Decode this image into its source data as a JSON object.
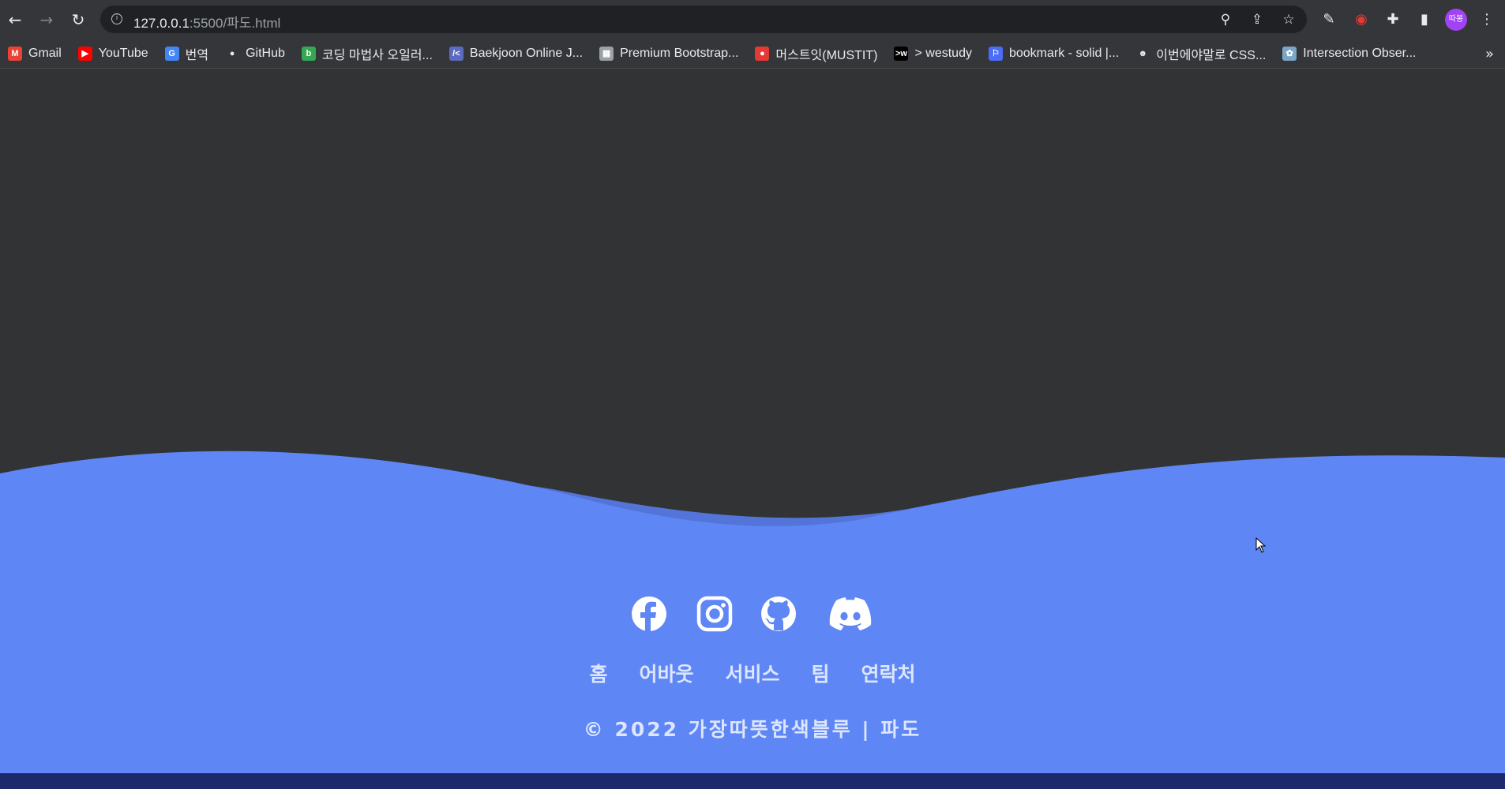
{
  "browser": {
    "url_host": "127.0.0.1",
    "url_rest": ":5500/파도.html",
    "profile_label": "따봉"
  },
  "bookmarks": [
    {
      "label": "Gmail",
      "color": "#ea4335",
      "glyph": "M"
    },
    {
      "label": "YouTube",
      "color": "#ff0000",
      "glyph": "▶"
    },
    {
      "label": "번역",
      "color": "#4285f4",
      "glyph": "G"
    },
    {
      "label": "GitHub",
      "color": "#e8eaed",
      "glyph": "●"
    },
    {
      "label": "코딩 마법사 오일러...",
      "color": "#34a853",
      "glyph": "b"
    },
    {
      "label": "Baekjoon Online J...",
      "color": "#5c6bc0",
      "glyph": "/<"
    },
    {
      "label": "Premium Bootstrap...",
      "color": "#9aa0a6",
      "glyph": "▦"
    },
    {
      "label": "머스트잇(MUSTIT)",
      "color": "#e53935",
      "glyph": "●"
    },
    {
      "label": "> westudy",
      "color": "#000000",
      "glyph": ">w"
    },
    {
      "label": "bookmark - solid |...",
      "color": "#4a6cf7",
      "glyph": "⚐"
    },
    {
      "label": "이번에야말로 CSS...",
      "color": "#e8eaed",
      "glyph": "☻"
    },
    {
      "label": "Intersection Obser...",
      "color": "#7aa7c7",
      "glyph": "✿"
    }
  ],
  "footer": {
    "socials": [
      "facebook-icon",
      "instagram-icon",
      "github-icon",
      "discord-icon"
    ],
    "links": [
      "홈",
      "어바웃",
      "서비스",
      "팀",
      "연락처"
    ],
    "copyright": "© 2022 가장따뜻한색블루 | 파도"
  },
  "colors": {
    "page_bg": "#323334",
    "wave_blue": "#5e86f5",
    "wave_back": "#5374d8"
  }
}
